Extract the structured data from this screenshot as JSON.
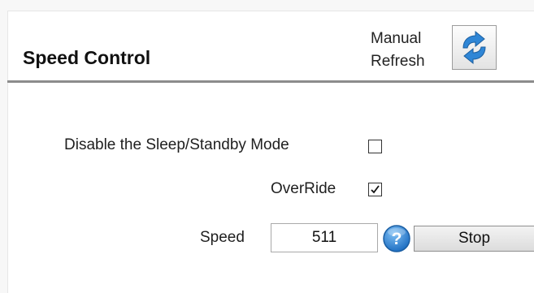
{
  "header": {
    "title": "Speed Control",
    "refresh_label_line1": "Manual",
    "refresh_label_line2": "Refresh"
  },
  "settings": {
    "sleep_mode_label": "Disable the Sleep/Standby Mode",
    "sleep_mode_checked": false,
    "override_label": "OverRide",
    "override_checked": true,
    "speed_label": "Speed",
    "speed_value": "511",
    "stop_label": "Stop"
  },
  "icons": {
    "refresh": "refresh-arrows-icon",
    "help": "question-mark-icon",
    "checkmark": "checkmark-icon"
  },
  "colors": {
    "accent_blue": "#2f86d6",
    "header_rule": "#8c8c8c"
  }
}
